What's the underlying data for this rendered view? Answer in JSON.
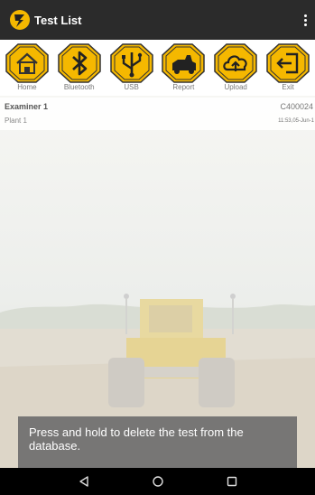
{
  "app": {
    "title": "Test List"
  },
  "toolbar": {
    "accent": "#f5b800",
    "items": [
      {
        "label": "Home",
        "icon": "home-icon"
      },
      {
        "label": "Bluetooth",
        "icon": "bluetooth-icon"
      },
      {
        "label": "USB",
        "icon": "usb-icon"
      },
      {
        "label": "Report",
        "icon": "report-icon"
      },
      {
        "label": "Upload",
        "icon": "upload-icon"
      },
      {
        "label": "Exit",
        "icon": "exit-icon"
      }
    ]
  },
  "tests": [
    {
      "examiner": "Examiner 1",
      "code": "C400024",
      "plant": "Plant 1",
      "timestamp": "11:53,05-Jun-1"
    }
  ],
  "toast": {
    "message": "Press and hold to delete the test from the database."
  },
  "navbar": {
    "icons": [
      "back-icon",
      "home-circle-icon",
      "recents-icon"
    ]
  }
}
